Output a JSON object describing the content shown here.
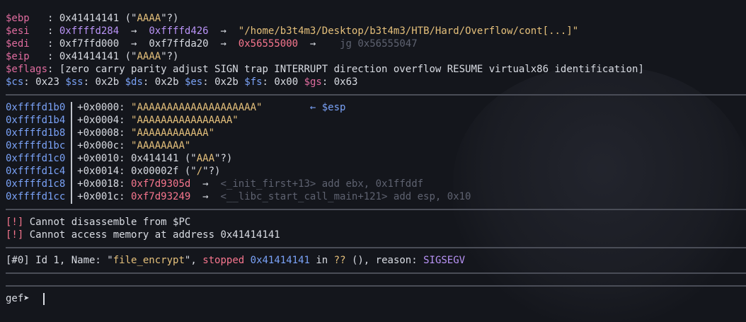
{
  "registers": {
    "ebp": {
      "name": "$ebp",
      "sep": "   : ",
      "value": "0x41414141",
      "note_pre": " (\"",
      "note": "AAAA",
      "note_post": "\"?)"
    },
    "esi": {
      "name": "$esi",
      "sep": "   : ",
      "value": "0xffffd284",
      "arrow1": "  →  ",
      "ptr": "0xffffd426",
      "arrow2": "  →  ",
      "str": "\"/home/b3t4m3/Desktop/b3t4m3/HTB/Hard/Overflow/cont[...]\""
    },
    "edi": {
      "name": "$edi",
      "sep": "   : ",
      "value": "0xf7ffd000",
      "arrow1": "  →  ",
      "ptr": "0xf7ffda20",
      "arrow2": "  →  ",
      "ptr2": "0x56555000",
      "arrow3": "  →  ",
      "instr": "  jg 0x56555047"
    },
    "eip": {
      "name": "$eip",
      "sep": "   : ",
      "value": "0x41414141",
      "note_pre": " (\"",
      "note": "AAAA",
      "note_post": "\"?)"
    },
    "eflags": {
      "name": "$eflags",
      "sep": ": ",
      "value": "[zero carry parity adjust SIGN trap INTERRUPT direction overflow RESUME virtualx86 identification]"
    },
    "segments": [
      {
        "name": "$cs",
        "value": ": 0x23 "
      },
      {
        "name": "$ss",
        "value": ": 0x2b "
      },
      {
        "name": "$ds",
        "value": ": 0x2b "
      },
      {
        "name": "$es",
        "value": ": 0x2b "
      },
      {
        "name": "$fs",
        "value": ": 0x00 "
      },
      {
        "name": "$gs",
        "value": ": 0x63"
      }
    ]
  },
  "stack": [
    {
      "addr": "0xffffd1b0",
      "off": "+0x0000: ",
      "val": "\"AAAAAAAAAAAAAAAAAAAA\"",
      "extra": "        ← $esp"
    },
    {
      "addr": "0xffffd1b4",
      "off": "+0x0004: ",
      "val": "\"AAAAAAAAAAAAAAAA\""
    },
    {
      "addr": "0xffffd1b8",
      "off": "+0x0008: ",
      "val": "\"AAAAAAAAAAAA\""
    },
    {
      "addr": "0xffffd1bc",
      "off": "+0x000c: ",
      "val": "\"AAAAAAAA\""
    },
    {
      "addr": "0xffffd1c0",
      "off": "+0x0010: ",
      "plain": "0x414141 (\"",
      "q": "AAA",
      "tail": "\"?)"
    },
    {
      "addr": "0xffffd1c4",
      "off": "+0x0014: ",
      "plain": "0x00002f (\"",
      "q": "/",
      "tail": "\"?)"
    },
    {
      "addr": "0xffffd1c8",
      "off": "+0x0018: ",
      "red": "0xf7d9305d",
      "arrow": "  →  ",
      "sym": "<_init_first+13> add ebx, 0x1ffddf"
    },
    {
      "addr": "0xffffd1cc",
      "off": "+0x001c: ",
      "red": "0xf7d93249",
      "arrow": "  →  ",
      "sym": "<__libc_start_call_main+121> add esp, 0x10"
    }
  ],
  "errors": [
    {
      "tag": "[!]",
      "text": " Cannot disassemble from $PC"
    },
    {
      "tag": "[!]",
      "text": " Cannot access memory at address 0x41414141"
    }
  ],
  "thread": {
    "tag": "[#0]",
    "p1": " Id 1, Name: \"",
    "name": "file_encrypt",
    "p2": "\", ",
    "status": "stopped",
    "p3": " ",
    "addr": "0x41414141",
    "p4": " in ",
    "func": "??",
    "p5": " (), reason: ",
    "reason": "SIGSEGV"
  },
  "prompt": {
    "text": "gef➤ "
  }
}
